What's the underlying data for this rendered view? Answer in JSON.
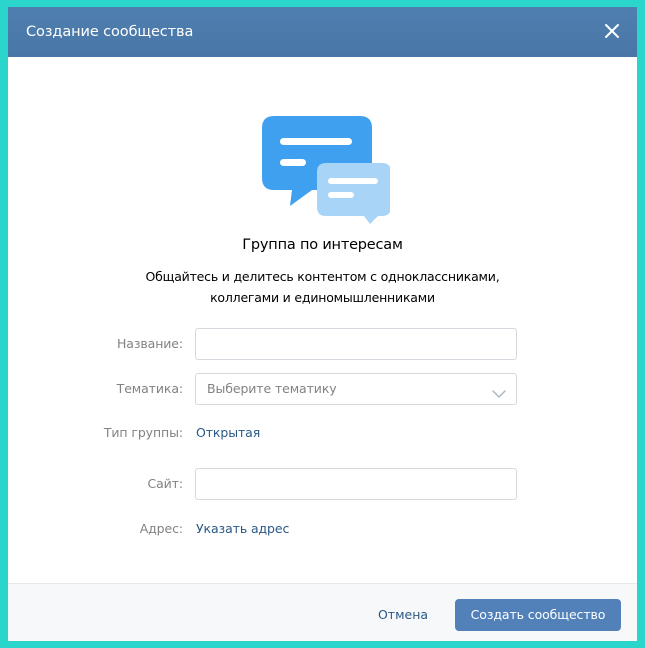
{
  "modal": {
    "title": "Создание сообщества",
    "close_icon": "close-icon"
  },
  "illustration": {
    "icon": "chat-bubbles-icon",
    "colors": {
      "primary": "#3fa0f0",
      "secondary": "#a8d4f8"
    }
  },
  "group": {
    "title": "Группа по интересам",
    "description_line1": "Общайтесь и делитесь контентом с одноклассниками,",
    "description_line2": "коллегами и единомышленниками"
  },
  "form": {
    "name_label": "Название:",
    "name_value": "",
    "topic_label": "Тематика:",
    "topic_placeholder": "Выберите тематику",
    "group_type_label": "Тип группы:",
    "group_type_value": "Открытая",
    "site_label": "Сайт:",
    "site_value": "",
    "address_label": "Адрес:",
    "address_link": "Указать адрес"
  },
  "footer": {
    "cancel_label": "Отмена",
    "create_label": "Создать сообщество"
  },
  "colors": {
    "frame": "#2ad6cc",
    "header": "#4a76a8",
    "link": "#2a5885",
    "button": "#5181b8"
  }
}
